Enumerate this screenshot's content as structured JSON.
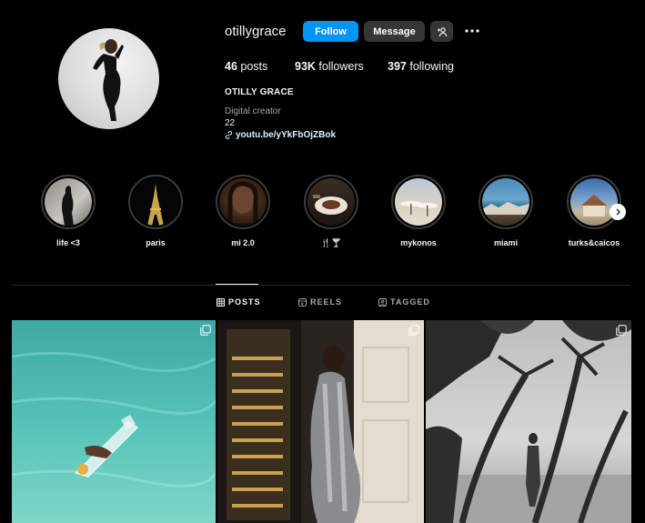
{
  "profile": {
    "username": "otillygrace",
    "follow_label": "Follow",
    "message_label": "Message",
    "full_name": "OTILLY GRACE",
    "category": "Digital creator",
    "bio_line": "22",
    "link": "youtu.be/yYkFbOjZBok"
  },
  "stats": {
    "posts_count": "46",
    "posts_label": "posts",
    "followers_count": "93K",
    "followers_label": "followers",
    "following_count": "397",
    "following_label": "following"
  },
  "highlights": [
    {
      "label": "life <3"
    },
    {
      "label": "paris"
    },
    {
      "label": "mi 2.0"
    },
    {
      "label": "🍴🍸"
    },
    {
      "label": "mykonos"
    },
    {
      "label": "miami"
    },
    {
      "label": "turks&caicos"
    }
  ],
  "tabs": [
    {
      "label": "POSTS"
    },
    {
      "label": "REELS"
    },
    {
      "label": "TAGGED"
    }
  ],
  "colors": {
    "background": "#000000",
    "accent": "#0095f6",
    "button_secondary": "#363636",
    "text_secondary": "#a8a8a8"
  }
}
